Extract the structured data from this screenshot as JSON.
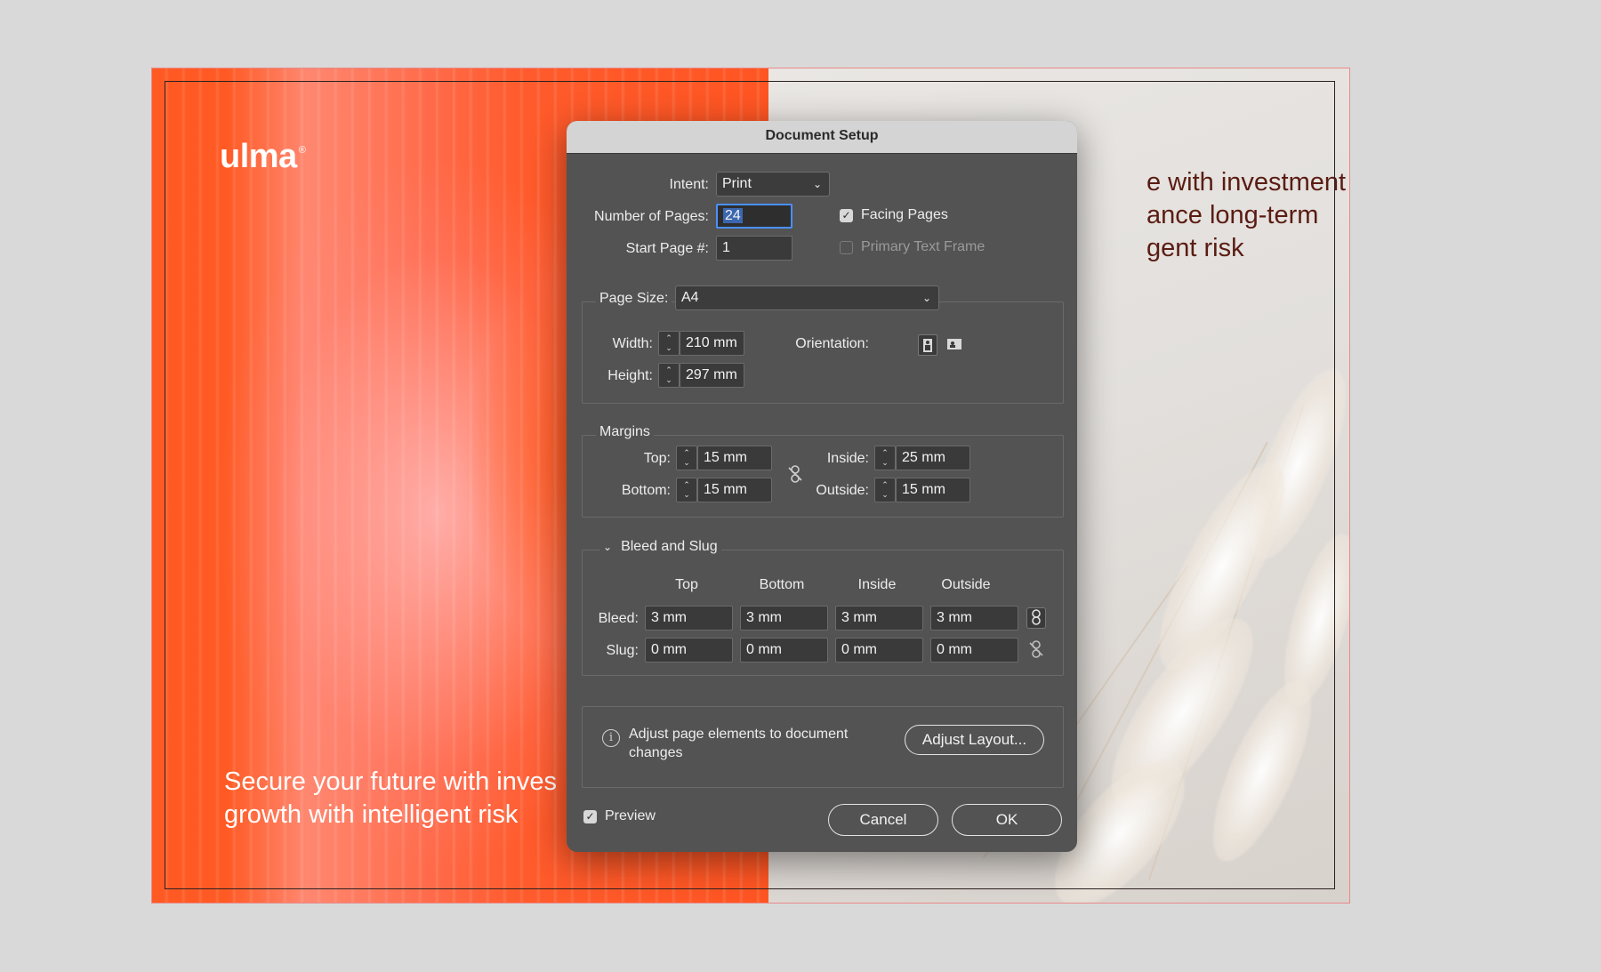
{
  "canvas": {
    "logo_text": "ulma",
    "logo_mark": "®",
    "left_tagline_line1": "Secure your future with inves",
    "left_tagline_line2": "growth with intelligent risk",
    "right_tagline_line1": "e with investment",
    "right_tagline_line2": "ance long-term",
    "right_tagline_line3": "gent risk"
  },
  "dialog": {
    "title": "Document Setup",
    "intent_label": "Intent:",
    "intent_value": "Print",
    "pages_label": "Number of Pages:",
    "pages_value": "24",
    "start_label": "Start Page #:",
    "start_value": "1",
    "facing_pages_label": "Facing Pages",
    "facing_pages_checked": true,
    "primary_text_frame_label": "Primary Text Frame",
    "primary_text_frame_checked": false,
    "page_size_label": "Page Size:",
    "page_size_value": "A4",
    "width_label": "Width:",
    "width_value": "210 mm",
    "height_label": "Height:",
    "height_value": "297 mm",
    "orientation_label": "Orientation:",
    "margins": {
      "title": "Margins",
      "top_label": "Top:",
      "top_value": "15 mm",
      "bottom_label": "Bottom:",
      "bottom_value": "15 mm",
      "inside_label": "Inside:",
      "inside_value": "25 mm",
      "outside_label": "Outside:",
      "outside_value": "15 mm"
    },
    "bleed_slug": {
      "title": "Bleed and Slug",
      "columns": [
        "Top",
        "Bottom",
        "Inside",
        "Outside"
      ],
      "bleed_label": "Bleed:",
      "bleed_values": [
        "3 mm",
        "3 mm",
        "3 mm",
        "3 mm"
      ],
      "slug_label": "Slug:",
      "slug_values": [
        "0 mm",
        "0 mm",
        "0 mm",
        "0 mm"
      ]
    },
    "adjust": {
      "info_line1": "Adjust page elements to document",
      "info_line2": "changes",
      "button": "Adjust Layout..."
    },
    "preview_label": "Preview",
    "preview_checked": true,
    "cancel_label": "Cancel",
    "ok_label": "OK"
  }
}
